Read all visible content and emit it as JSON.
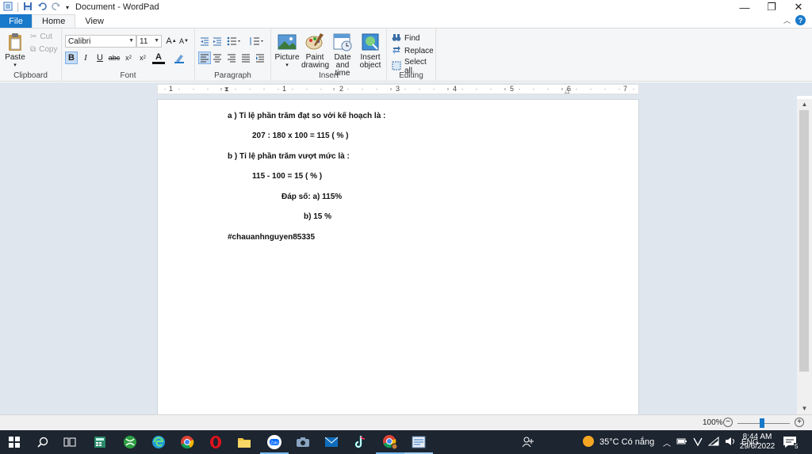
{
  "window": {
    "title": "Document - WordPad",
    "minimize": "—",
    "maximize": "❐",
    "close": "✕"
  },
  "tabs": [
    {
      "label": "File"
    },
    {
      "label": "Home"
    },
    {
      "label": "View"
    }
  ],
  "ribbon": {
    "clipboard": {
      "label": "Clipboard",
      "paste": "Paste",
      "cut": "Cut",
      "copy": "Copy"
    },
    "font": {
      "label": "Font",
      "family": "Calibri",
      "size": "11"
    },
    "paragraph": {
      "label": "Paragraph"
    },
    "insert": {
      "label": "Insert",
      "picture": "Picture",
      "paint_drawing": "Paint drawing",
      "date_time": "Date and time",
      "insert_object": "Insert object"
    },
    "editing": {
      "label": "Editing",
      "find": "Find",
      "replace": "Replace",
      "select_all": "Select all"
    }
  },
  "ruler": {
    "numbers": [
      "1",
      "1",
      "2",
      "3",
      "4",
      "5",
      "6",
      "7"
    ]
  },
  "document": {
    "lines": [
      "a ) Tỉ lệ phần trăm đạt so với kế hoạch là :",
      "207 : 180 x 100 = 115 ( % )",
      "b ) Tỉ lệ phần trăm vượt mức là :",
      "115 - 100 = 15 ( % )",
      "Đáp số: a) 115%",
      "b) 15 %",
      "#chauanhnguyen85335"
    ]
  },
  "statusbar": {
    "zoom": "100%",
    "zoom_level_percent": 100
  },
  "taskbar": {
    "weather": "35°C  Có nắng",
    "language": "ENG",
    "time": "8:44 AM",
    "date": "29/6/2022",
    "notification_count": "5"
  },
  "colors": {
    "accent": "#1979ca",
    "taskbar": "#1c2530",
    "workspace": "#dfe6ee"
  }
}
